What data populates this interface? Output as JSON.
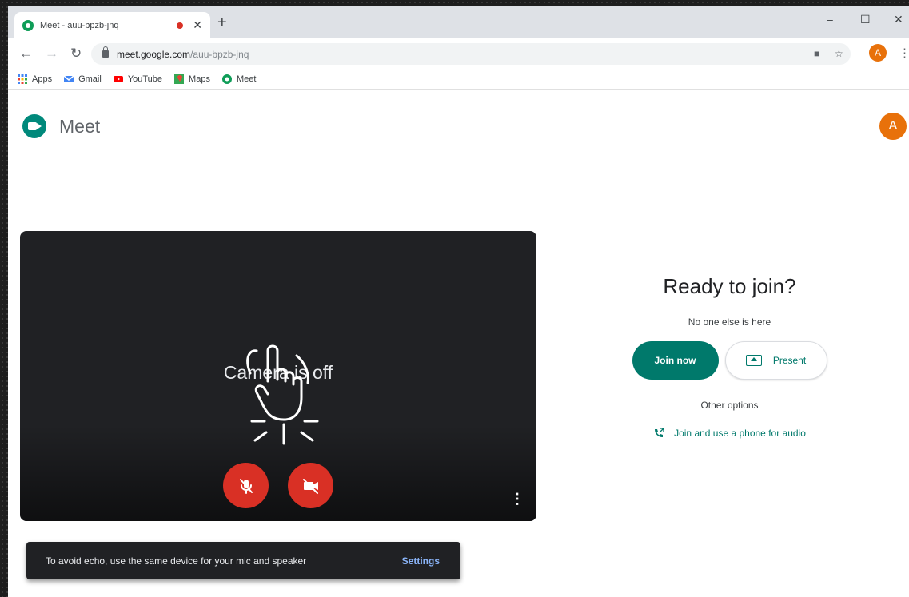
{
  "browser": {
    "tab_title": "Meet - auu-bpzb-jnq",
    "tab_close": "✕",
    "new_tab": "+",
    "window_controls": {
      "minimize": "–",
      "maximize": "☐",
      "close": "✕"
    },
    "url_host": "meet.google.com",
    "url_path": "/auu-bpzb-jnq",
    "profile_initial": "A",
    "bookmarks": [
      {
        "label": "Apps",
        "icon": "apps-grid-icon",
        "color": "#4285f4"
      },
      {
        "label": "Gmail",
        "icon": "gmail-icon",
        "color": "#4285f4"
      },
      {
        "label": "YouTube",
        "icon": "youtube-icon",
        "color": "#ff0000"
      },
      {
        "label": "Maps",
        "icon": "maps-icon",
        "color": "#34a853"
      },
      {
        "label": "Meet",
        "icon": "meet-icon",
        "color": "#0f9d58"
      }
    ]
  },
  "page": {
    "product_name": "Meet",
    "avatar_initial": "A",
    "preview": {
      "camera_status": "Camera is off",
      "mic_state": "muted",
      "camera_state": "off"
    },
    "join": {
      "heading": "Ready to join?",
      "subtext": "No one else is here",
      "join_label": "Join now",
      "present_label": "Present",
      "other_options": "Other options",
      "phone_label": "Join and use a phone for audio"
    },
    "toast": {
      "message": "To avoid echo, use the same device for your mic and speaker",
      "action": "Settings"
    }
  },
  "colors": {
    "accent": "#00796b",
    "danger": "#d93025",
    "profile": "#e8710a"
  }
}
